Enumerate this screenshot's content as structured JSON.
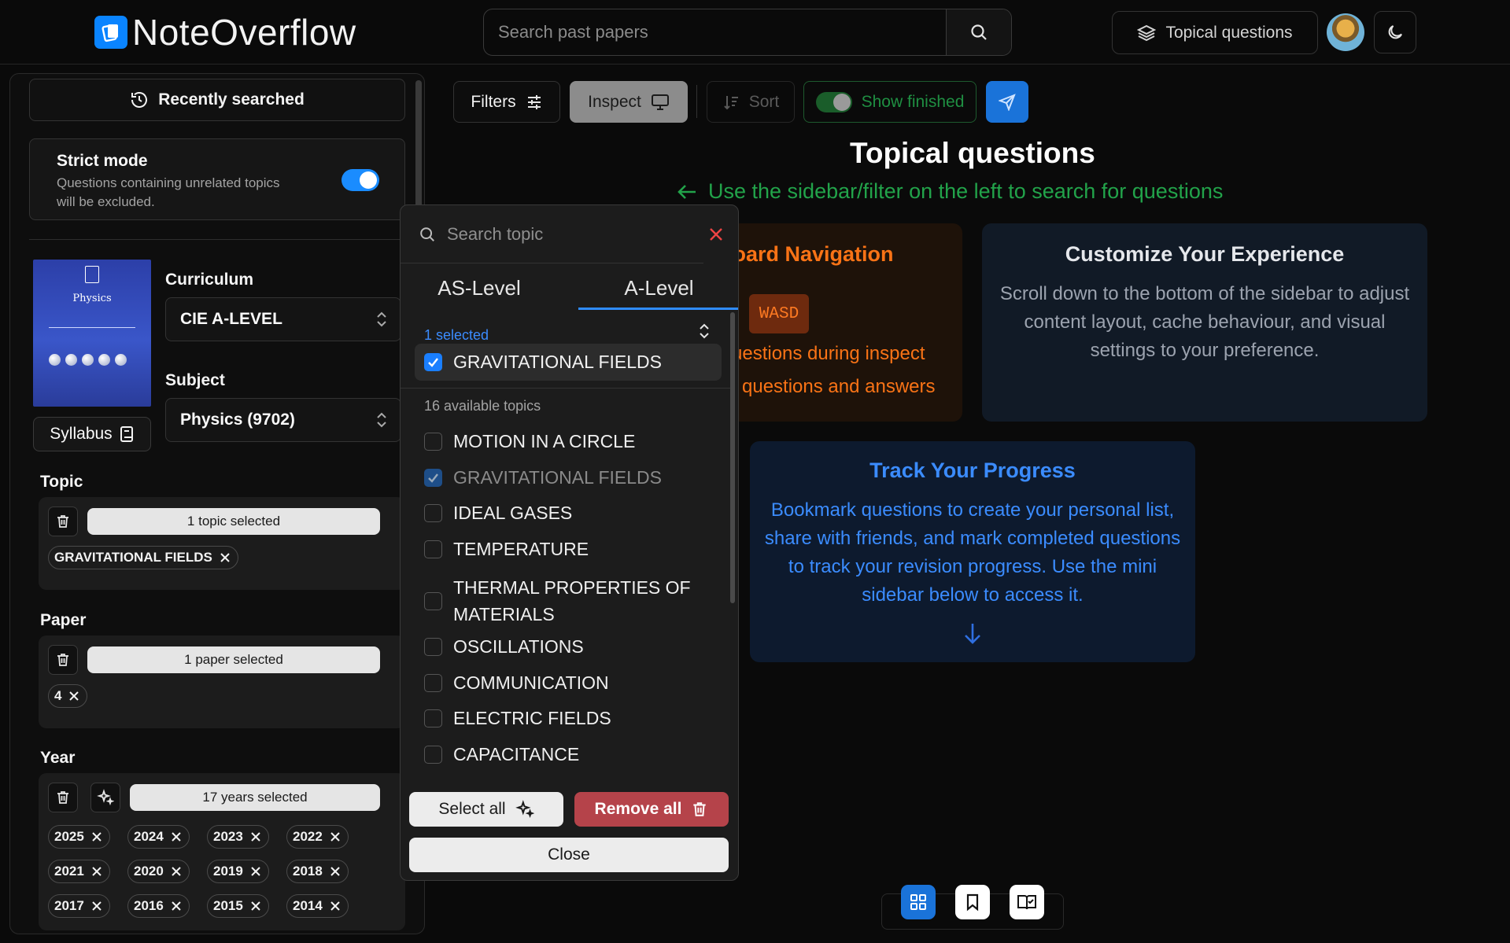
{
  "header": {
    "logo_text": "NoteOverflow",
    "search_placeholder": "Search past papers",
    "topical_label": "Topical questions"
  },
  "sidebar": {
    "recently_searched": "Recently searched",
    "strict_title": "Strict mode",
    "strict_desc": "Questions containing unrelated topics will be excluded.",
    "strict_on": true,
    "book_title": "Physics",
    "syllabus_label": "Syllabus",
    "curriculum_label": "Curriculum",
    "curriculum_value": "CIE A-LEVEL",
    "subject_label": "Subject",
    "subject_value": "Physics (9702)",
    "topic_label": "Topic",
    "topic_summary": "1 topic selected",
    "topic_chips": [
      "GRAVITATIONAL FIELDS"
    ],
    "paper_label": "Paper",
    "paper_summary": "1 paper selected",
    "paper_chips": [
      "4"
    ],
    "year_label": "Year",
    "year_summary": "17 years selected",
    "year_chips": [
      "2025",
      "2024",
      "2023",
      "2022",
      "2021",
      "2020",
      "2019",
      "2018",
      "2017",
      "2016",
      "2015",
      "2014"
    ]
  },
  "toolbar": {
    "filters": "Filters",
    "inspect": "Inspect",
    "sort": "Sort",
    "show_finished": "Show finished"
  },
  "main": {
    "title": "Topical questions",
    "hint": "Use the sidebar/filter on the left to search for questions",
    "card_keyboard": {
      "title": "yboard Navigation",
      "kbd": "WASD",
      "text1": "uestions during inspect",
      "text2": "questions and answers"
    },
    "card_customize": {
      "title": "Customize Your Experience",
      "text": "Scroll down to the bottom of the sidebar to adjust content layout, cache behaviour, and visual settings to your preference."
    },
    "card_progress": {
      "title": "Track Your Progress",
      "text": "Bookmark questions to create your personal list, share with friends, and mark completed questions to track your revision progress. Use the mini sidebar below to access it."
    }
  },
  "dropdown": {
    "search_placeholder": "Search topic",
    "tabs": [
      "AS-Level",
      "A-Level"
    ],
    "active_tab": "A-Level",
    "selected_count": "1 selected",
    "selected_items": [
      "GRAVITATIONAL FIELDS"
    ],
    "available_label": "16 available topics",
    "options": [
      {
        "label": "MOTION IN A CIRCLE",
        "checked": false
      },
      {
        "label": "GRAVITATIONAL FIELDS",
        "checked": true
      },
      {
        "label": "IDEAL GASES",
        "checked": false
      },
      {
        "label": "TEMPERATURE",
        "checked": false
      },
      {
        "label": "THERMAL PROPERTIES OF MATERIALS",
        "checked": false
      },
      {
        "label": "OSCILLATIONS",
        "checked": false
      },
      {
        "label": "COMMUNICATION",
        "checked": false
      },
      {
        "label": "ELECTRIC FIELDS",
        "checked": false
      },
      {
        "label": "CAPACITANCE",
        "checked": false
      }
    ],
    "select_all": "Select all",
    "remove_all": "Remove all",
    "close": "Close"
  },
  "colors": {
    "accent_blue": "#1a8cff",
    "success_green": "#22a34a",
    "warning_orange": "#f97316",
    "danger_red": "#b5434a"
  }
}
